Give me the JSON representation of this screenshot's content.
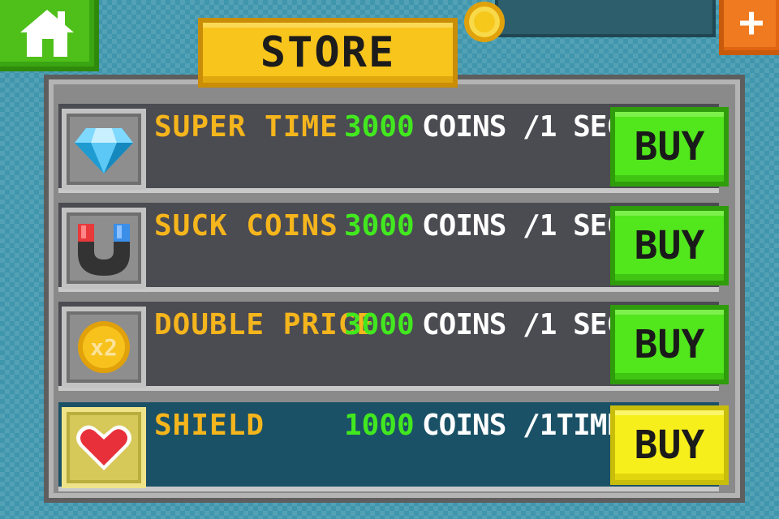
{
  "header": {
    "title": "STORE",
    "coin_balance": ""
  },
  "items": [
    {
      "name": "SUPER TIME",
      "price": "3000",
      "unit": "COINS /1 SEC",
      "buy_label": "BUY",
      "icon": "diamond-icon"
    },
    {
      "name": "SUCK COINS",
      "price": "3000",
      "unit": "COINS /1 SEC",
      "buy_label": "BUY",
      "icon": "magnet-icon"
    },
    {
      "name": "DOUBLE PRICE",
      "price": "3000",
      "unit": "COINS /1 SEC",
      "buy_label": "BUY",
      "icon": "x2-coin-icon"
    },
    {
      "name": "SHIELD",
      "price": "1000",
      "unit": "COINS /1TIME",
      "buy_label": "BUY",
      "icon": "heart-icon"
    }
  ],
  "colors": {
    "background": "#3f96ad",
    "title_yellow": "#f8c51c",
    "name_orange": "#f5b51c",
    "price_green": "#42e81f",
    "buy_green": "#52e61d",
    "buy_selected_yellow": "#f7ef1c",
    "row_selected": "#1b5166"
  }
}
